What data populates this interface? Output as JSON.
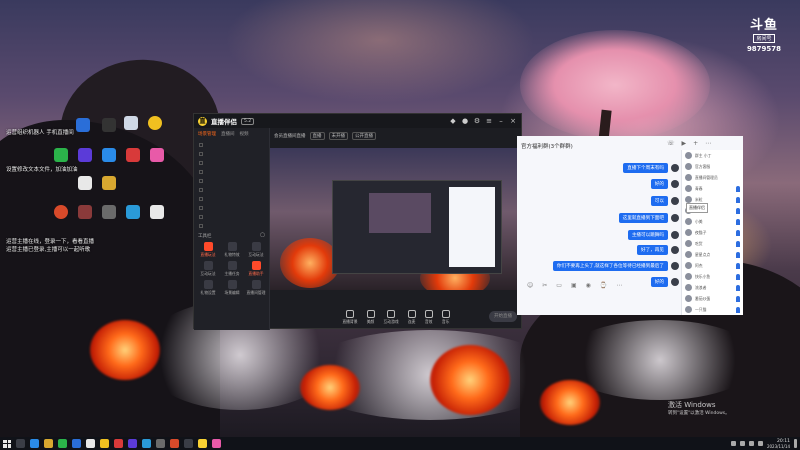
{
  "douyu": {
    "mark": "斗鱼",
    "sub": "房间号",
    "room_id": "9879578"
  },
  "desktop": {
    "left_texts": [
      "运营组织机器人 手机直播间",
      "",
      "设置修改文本文件，加油加油",
      "",
      "",
      "",
      "",
      "",
      "",
      "",
      "",
      "",
      "",
      "",
      "",
      "",
      "",
      "运营主播在线，登录一下，看看直播",
      "运营主播已登录,主播可以一起听歌"
    ]
  },
  "activate": {
    "title": "激活 Windows",
    "hint": "转到\"设置\"以激活 Windows。"
  },
  "stream_app": {
    "name": "直播伴侣",
    "version": "5.2",
    "scene_tabs": [
      "场景管理",
      "直播间",
      "视频"
    ],
    "tools_title": "工具栏",
    "tools": [
      "直播玩法",
      "礼物特效",
      "互动玩法",
      "互动玩法",
      "主播任务",
      "直播助手",
      "礼物设置",
      "场景编辑",
      "直播间管理"
    ],
    "room": {
      "title": "会员直播间直播",
      "tag": "直播",
      "pill1": "未开播",
      "pill2": "公开直播"
    },
    "controls": [
      "直播背景",
      "美颜",
      "互动游戏",
      "连麦",
      "音效",
      "音乐"
    ],
    "live_button": "开始直播"
  },
  "chat": {
    "title": "官方福利群(3个群群)",
    "messages": [
      "直播下个周末有吗",
      "好的",
      "可以",
      "这里就直播到下面吧",
      "主播可以跳舞吗",
      "好了，再见",
      "你们不要再上头了,就这样了各位等待已经播到最后了",
      "好的"
    ],
    "members": [
      "群主 小丁",
      "官方客服",
      "直播间管理员",
      "青春",
      "米粒",
      "蓝天",
      "小美",
      "夜猫子",
      "吃货",
      "星星点点",
      "阿杰",
      "快乐小鱼",
      "流浪者",
      "番茄炒蛋",
      "一只猫"
    ],
    "tooltip": "直播伴侣"
  },
  "taskbar": {
    "time": "20:11",
    "date": "2023/11/14"
  },
  "colors": {
    "accent": "#ff6a1a",
    "chat_bubble": "#1e6cf0"
  }
}
